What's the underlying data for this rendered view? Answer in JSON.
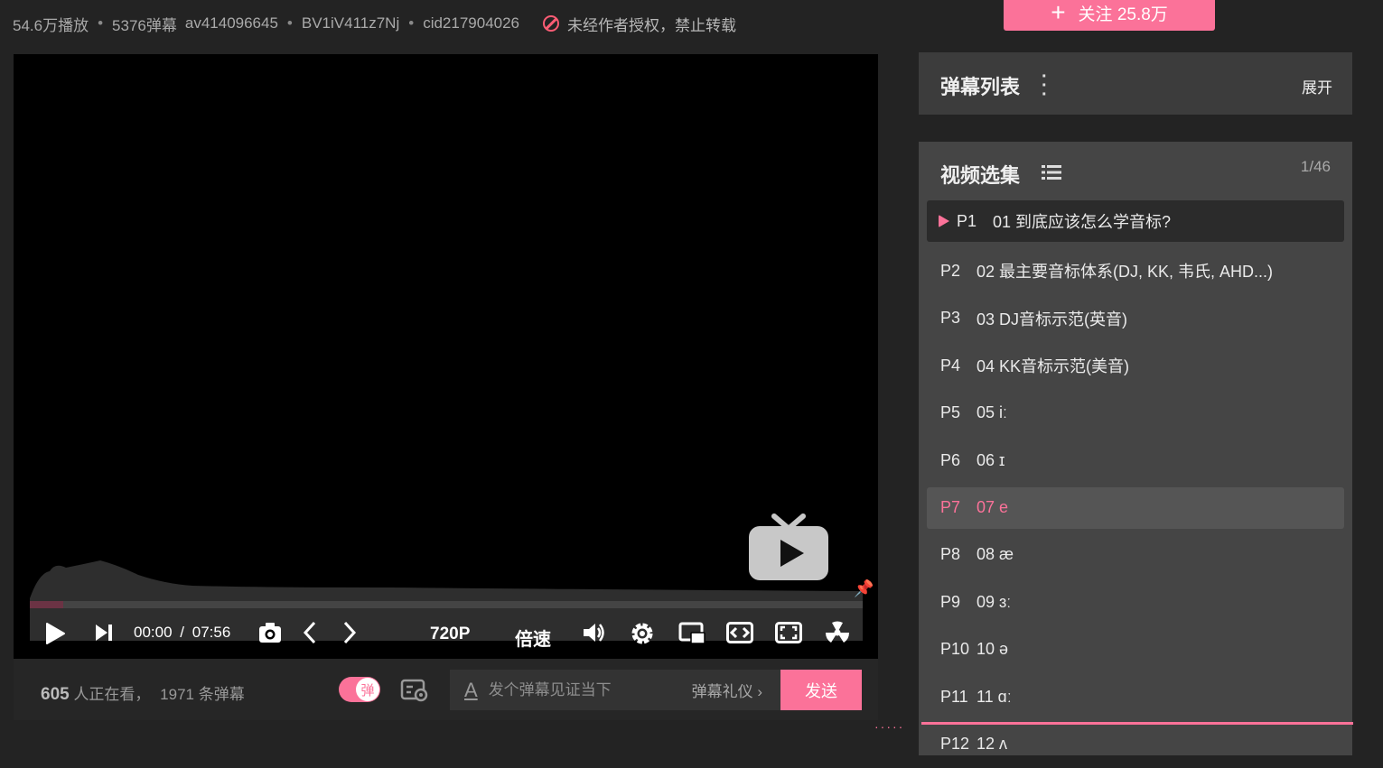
{
  "meta": {
    "views": "54.6万播放",
    "danmaku": "5376弹幕",
    "av": "av414096645",
    "bv": "BV1iV411z7Nj",
    "cid": "cid217904026",
    "copyright": "未经作者授权，禁止转载"
  },
  "follow": {
    "label": "关注 25.8万"
  },
  "player": {
    "current_time": "00:00",
    "separator": "/",
    "duration": "07:56",
    "quality": "720P",
    "speed": "倍速",
    "progress": 0.04
  },
  "danmaku_bar": {
    "viewers": "605",
    "viewers_suffix": "人正在看，",
    "count_text": "1971 条弹幕",
    "toggle_label": "弹",
    "placeholder": "发个弹幕见证当下",
    "etiquette": "弹幕礼仪",
    "send": "发送"
  },
  "danmaku_list": {
    "title": "弹幕列表",
    "expand": "展开"
  },
  "episodes": {
    "title": "视频选集",
    "count": "1/46",
    "items": [
      {
        "p": "P1",
        "title": "01 到底应该怎么学音标?"
      },
      {
        "p": "P2",
        "title": "02 最主要音标体系(DJ, KK, 韦氏, AHD...)"
      },
      {
        "p": "P3",
        "title": "03 DJ音标示范(英音)"
      },
      {
        "p": "P4",
        "title": "04 KK音标示范(美音)"
      },
      {
        "p": "P5",
        "title": "05 iː"
      },
      {
        "p": "P6",
        "title": "06 ɪ"
      },
      {
        "p": "P7",
        "title": "07 e"
      },
      {
        "p": "P8",
        "title": "08 æ"
      },
      {
        "p": "P9",
        "title": "09 ɜː"
      },
      {
        "p": "P10",
        "title": "10 ə"
      },
      {
        "p": "P11",
        "title": "11 ɑː"
      },
      {
        "p": "P12",
        "title": "12 ʌ"
      }
    ]
  },
  "colors": {
    "accent": "#fb7299",
    "bg": "#232323",
    "panel": "#454545"
  }
}
